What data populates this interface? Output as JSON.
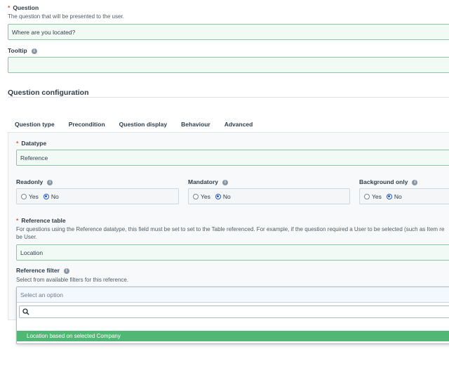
{
  "question": {
    "label": "Question",
    "help": "The question that will be presented to the user.",
    "value": "Where are you located?"
  },
  "tooltip": {
    "label": "Tooltip",
    "value": ""
  },
  "config": {
    "heading": "Question configuration",
    "tabs": [
      "Question type",
      "Precondition",
      "Question display",
      "Behaviour",
      "Advanced"
    ],
    "active_tab": "Question type"
  },
  "datatype": {
    "label": "Datatype",
    "value": "Reference"
  },
  "radios": {
    "yes_label": "Yes",
    "no_label": "No",
    "readonly": {
      "label": "Readonly",
      "selected": "No"
    },
    "mandatory": {
      "label": "Mandatory",
      "selected": "No"
    },
    "background_only": {
      "label": "Background only",
      "selected": "No"
    }
  },
  "reference_table": {
    "label": "Reference table",
    "help_line1": "For questions using the Reference datatype, this field must be set to set to the Table referenced. For example, if the question required a User to be selected (such as Item re",
    "help_line2": "be User.",
    "value": "Location"
  },
  "reference_filter": {
    "label": "Reference filter",
    "help": "Select from available filters for this reference.",
    "placeholder": "Select an option",
    "search_value": "",
    "options": [
      "Location based on selected Company"
    ],
    "highlighted": 0
  },
  "colors": {
    "accent_green": "#50b874",
    "field_border": "#88c7a4",
    "required": "#e8532c",
    "radio_selected": "#1a56c6"
  }
}
